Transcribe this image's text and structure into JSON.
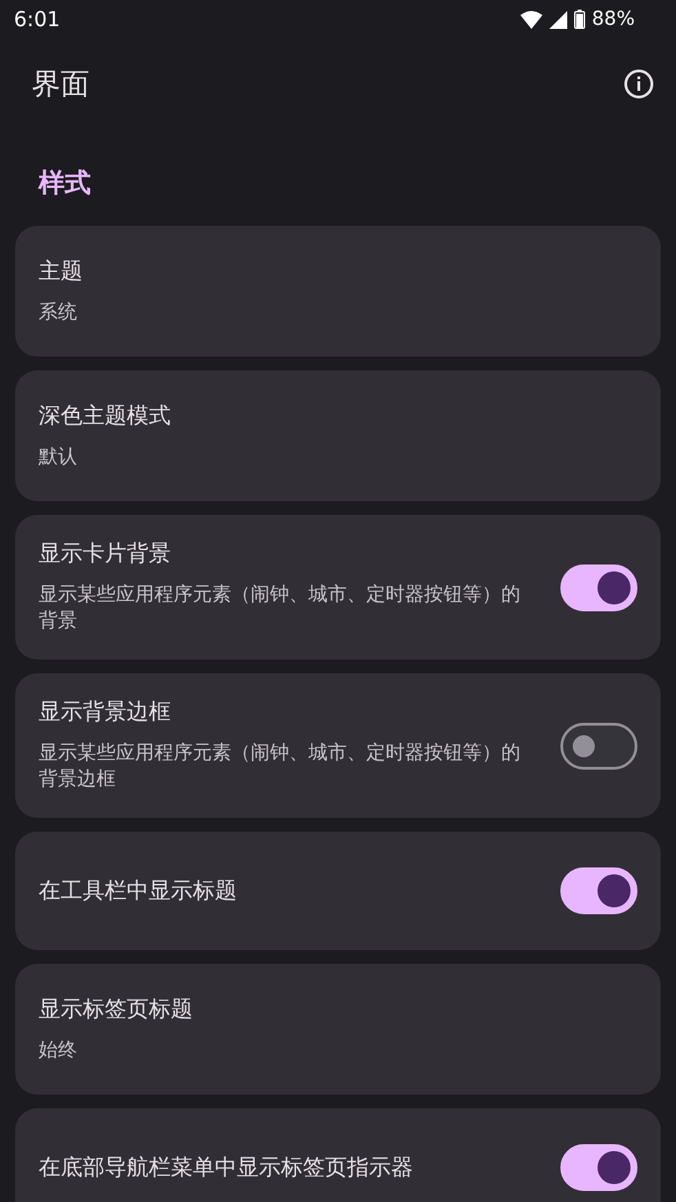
{
  "status_bar": {
    "time": "6:01",
    "battery": "88%"
  },
  "app_bar": {
    "title": "界面"
  },
  "section": {
    "title": "样式"
  },
  "items": [
    {
      "kind": "select",
      "title": "主题",
      "value": "系统"
    },
    {
      "kind": "select",
      "title": "深色主题模式",
      "value": "默认"
    },
    {
      "kind": "switch",
      "title": "显示卡片背景",
      "description": "显示某些应用程序元素（闹钟、城市、定时器按钮等）的背景",
      "on": true
    },
    {
      "kind": "switch",
      "title": "显示背景边框",
      "description": "显示某些应用程序元素（闹钟、城市、定时器按钮等）的背景边框",
      "on": false
    },
    {
      "kind": "switch",
      "title": "在工具栏中显示标题",
      "on": true
    },
    {
      "kind": "select",
      "title": "显示标签页标题",
      "value": "始终"
    },
    {
      "kind": "switch",
      "title": "在底部导航栏菜单中显示标签页指示器",
      "on": true
    }
  ]
}
